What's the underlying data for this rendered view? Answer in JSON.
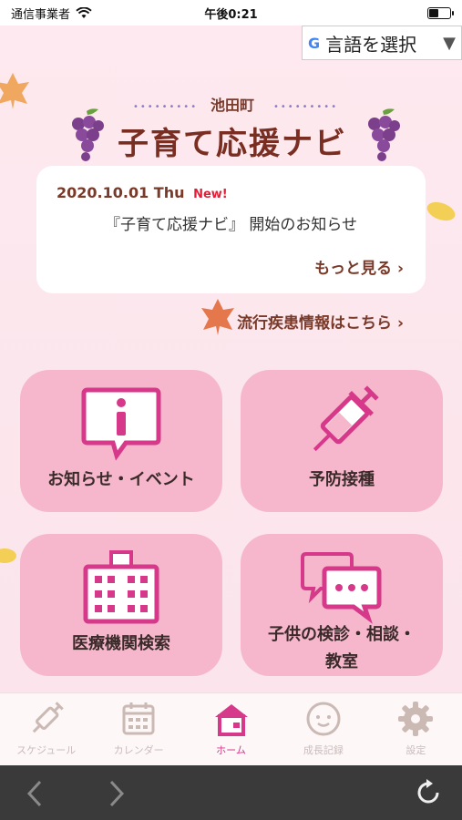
{
  "status_bar": {
    "carrier": "通信事業者",
    "time": "午後0:21"
  },
  "language_select": {
    "label": "言語を選択",
    "arrow": "▼"
  },
  "header": {
    "town": "池田町",
    "title": "子育て応援ナビ"
  },
  "news": {
    "date": "2020.10.01 Thu",
    "badge": "New!",
    "text": "『子育て応援ナビ』 開始のお知らせ",
    "more": "もっと見る"
  },
  "epidemic_link": "流行疾患情報はこちら",
  "menu": {
    "news_events": "お知らせ・イベント",
    "vaccination": "予防接種",
    "medical_search": "医療機関検索",
    "checkup_line1": "子供の検診・相談・",
    "checkup_line2": "教室"
  },
  "tabs": {
    "schedule": "スケジュール",
    "calendar": "カレンダー",
    "home": "ホーム",
    "growth": "成長記録",
    "settings": "設定"
  },
  "colors": {
    "accent": "#d6388a",
    "tile": "#f6b7cc",
    "title": "#7a2e22"
  }
}
